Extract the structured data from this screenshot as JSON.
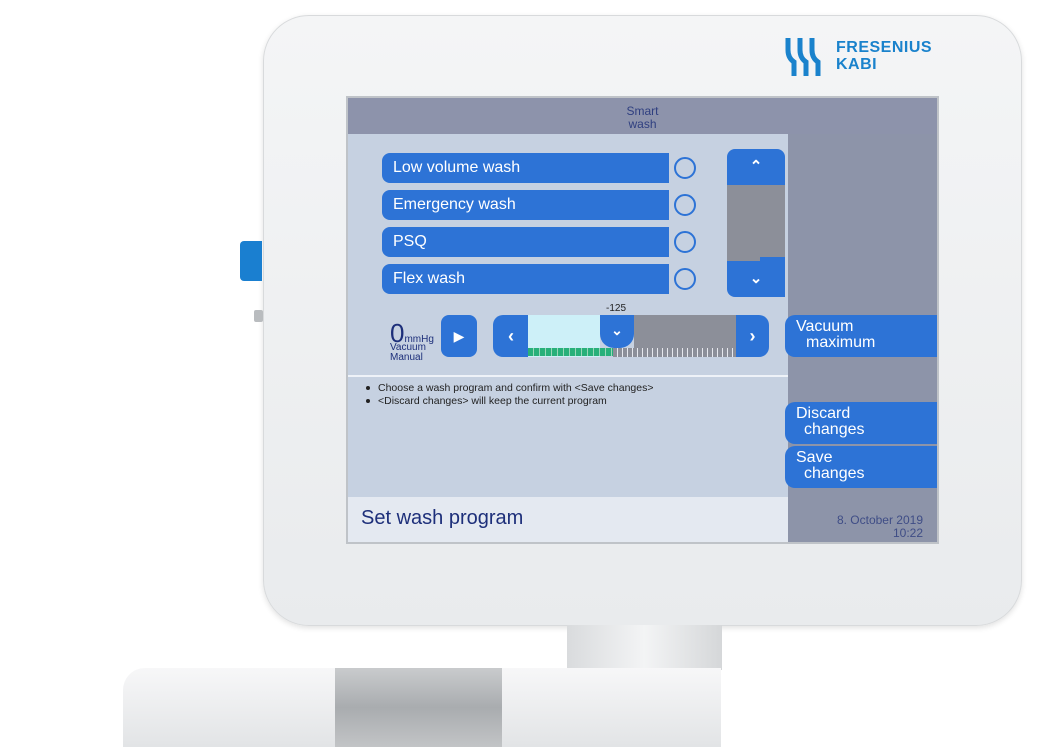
{
  "brand": {
    "name_line1": "FRESENIUS",
    "name_line2": "KABI",
    "color": "#1a82cc"
  },
  "header": {
    "title_line1": "Smart",
    "title_line2": "wash"
  },
  "programs": [
    {
      "label": "Low volume wash",
      "selected": false
    },
    {
      "label": "Emergency wash",
      "selected": false
    },
    {
      "label": "PSQ",
      "selected": false
    },
    {
      "label": "Flex wash",
      "selected": false
    }
  ],
  "scroll": {
    "up_icon": "chevron-up-icon",
    "down_icon": "chevron-down-icon"
  },
  "vacuum": {
    "value": "0",
    "unit": "mmHg",
    "label_line1": "Vacuum",
    "label_line2": "Manual",
    "setpoint": "-125"
  },
  "hints": [
    "Choose a wash program and confirm with <Save changes>",
    "<Discard changes> will keep the current program"
  ],
  "side_buttons": {
    "vacuum_max_line1": "Vacuum",
    "vacuum_max_line2": "maximum",
    "discard_line1": "Discard",
    "discard_line2": "changes",
    "save_line1": "Save",
    "save_line2": "changes"
  },
  "footer": {
    "title": "Set wash program"
  },
  "status": {
    "date": "8. October 2019",
    "time": "10:22"
  },
  "colors": {
    "accent": "#2d73d6",
    "panel": "#c6d1e1",
    "sidebar": "#8d94a9"
  }
}
